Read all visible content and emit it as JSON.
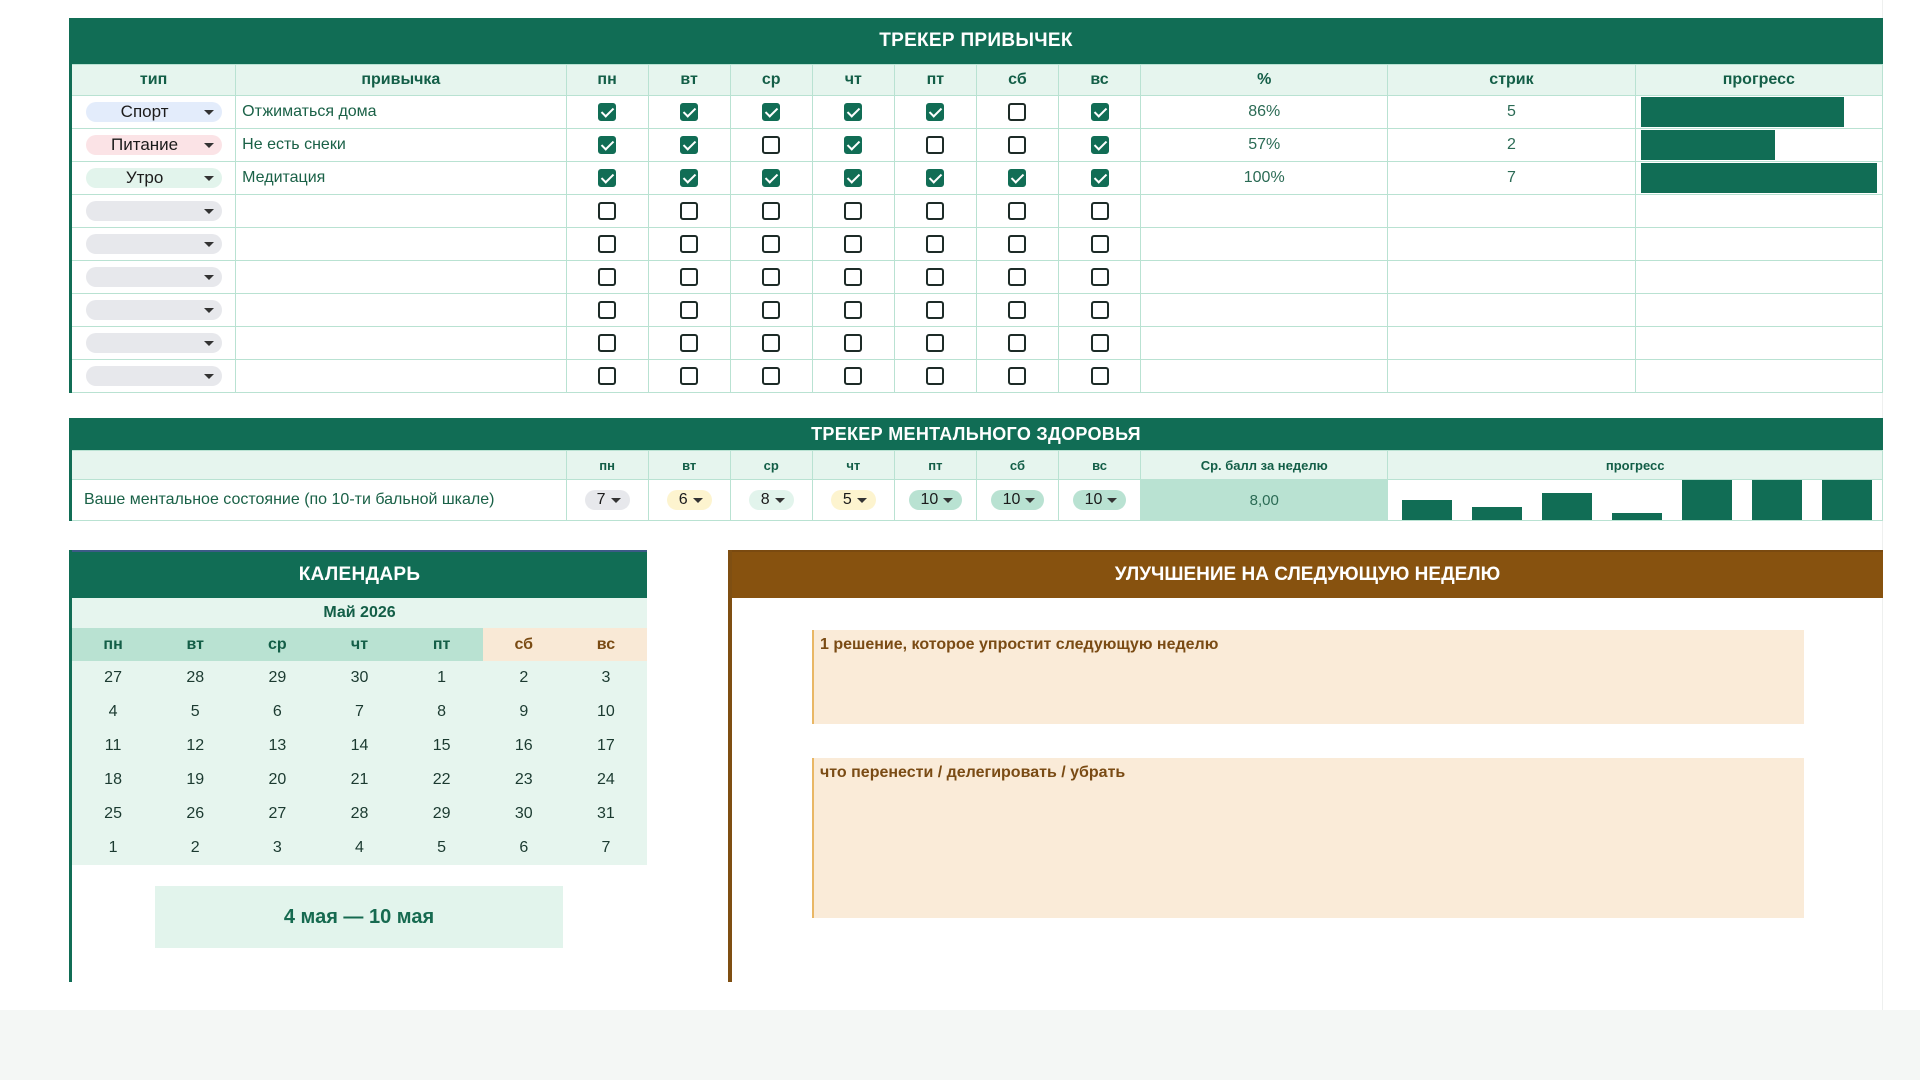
{
  "habit_tracker": {
    "title": "ТРЕКЕР ПРИВЫЧЕК",
    "headers": {
      "type": "тип",
      "habit": "привычка",
      "days": [
        "пн",
        "вт",
        "ср",
        "чт",
        "пт",
        "сб",
        "вс"
      ],
      "percent": "%",
      "streak": "стрик",
      "progress": "прогресс"
    },
    "rows": [
      {
        "type": "Спорт",
        "type_color": "#e3ecfb",
        "habit": "Отжиматься дома",
        "checks": [
          true,
          true,
          true,
          true,
          true,
          false,
          true
        ],
        "percent": "86%",
        "streak": "5",
        "progress": 0.86
      },
      {
        "type": "Питание",
        "type_color": "#fbe3e6",
        "habit": "Не есть снеки",
        "checks": [
          true,
          true,
          false,
          true,
          false,
          false,
          true
        ],
        "percent": "57%",
        "streak": "2",
        "progress": 0.57
      },
      {
        "type": "Утро",
        "type_color": "#e2f4ec",
        "habit": "Медитация",
        "checks": [
          true,
          true,
          true,
          true,
          true,
          true,
          true
        ],
        "percent": "100%",
        "streak": "7",
        "progress": 1.0
      },
      {
        "type": "",
        "habit": "",
        "checks": [
          false,
          false,
          false,
          false,
          false,
          false,
          false
        ],
        "percent": "",
        "streak": "",
        "progress": 0
      },
      {
        "type": "",
        "habit": "",
        "checks": [
          false,
          false,
          false,
          false,
          false,
          false,
          false
        ],
        "percent": "",
        "streak": "",
        "progress": 0
      },
      {
        "type": "",
        "habit": "",
        "checks": [
          false,
          false,
          false,
          false,
          false,
          false,
          false
        ],
        "percent": "",
        "streak": "",
        "progress": 0
      },
      {
        "type": "",
        "habit": "",
        "checks": [
          false,
          false,
          false,
          false,
          false,
          false,
          false
        ],
        "percent": "",
        "streak": "",
        "progress": 0
      },
      {
        "type": "",
        "habit": "",
        "checks": [
          false,
          false,
          false,
          false,
          false,
          false,
          false
        ],
        "percent": "",
        "streak": "",
        "progress": 0
      },
      {
        "type": "",
        "habit": "",
        "checks": [
          false,
          false,
          false,
          false,
          false,
          false,
          false
        ],
        "percent": "",
        "streak": "",
        "progress": 0
      }
    ]
  },
  "mental_tracker": {
    "title": "ТРЕКЕР МЕНТАЛЬНОГО ЗДОРОВЬЯ",
    "headers": {
      "days": [
        "пн",
        "вт",
        "ср",
        "чт",
        "пт",
        "сб",
        "вс"
      ],
      "avg": "Ср. балл за неделю",
      "progress": "прогресс"
    },
    "label": "Ваше ментальное состояние (по 10-ти бальной шкале)",
    "scores": [
      {
        "value": "7",
        "color": "#e7e8ec"
      },
      {
        "value": "6",
        "color": "#fdf4cf"
      },
      {
        "value": "8",
        "color": "#e2f4ec"
      },
      {
        "value": "5",
        "color": "#fdf4cf"
      },
      {
        "value": "10",
        "color": "#b9e2d2"
      },
      {
        "value": "10",
        "color": "#b9e2d2"
      },
      {
        "value": "10",
        "color": "#b9e2d2"
      }
    ],
    "avg": "8,00",
    "progress_values": [
      7,
      6,
      8,
      5,
      10,
      10,
      10
    ]
  },
  "calendar": {
    "title": "КАЛЕНДАРЬ",
    "month": "Май 2026",
    "weekdays": [
      "пн",
      "вт",
      "ср",
      "чт",
      "пт",
      "сб",
      "вс"
    ],
    "weeks": [
      [
        "27",
        "28",
        "29",
        "30",
        "1",
        "2",
        "3"
      ],
      [
        "4",
        "5",
        "6",
        "7",
        "8",
        "9",
        "10"
      ],
      [
        "11",
        "12",
        "13",
        "14",
        "15",
        "16",
        "17"
      ],
      [
        "18",
        "19",
        "20",
        "21",
        "22",
        "23",
        "24"
      ],
      [
        "25",
        "26",
        "27",
        "28",
        "29",
        "30",
        "31"
      ],
      [
        "1",
        "2",
        "3",
        "4",
        "5",
        "6",
        "7"
      ]
    ],
    "week_range": "4 мая — 10 мая"
  },
  "improvement": {
    "title": "УЛУЧШЕНИЕ НА СЛЕДУЮЩУЮ НЕДЕЛЮ",
    "notes": [
      {
        "label": "1 решение, которое упростит следующую неделю",
        "value": ""
      },
      {
        "label": "что перенести / делегировать / убрать",
        "value": ""
      }
    ]
  }
}
